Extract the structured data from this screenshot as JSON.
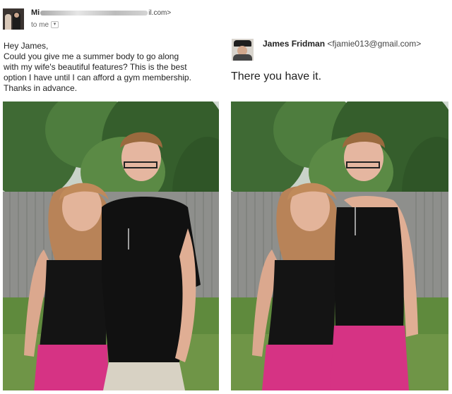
{
  "email": {
    "sender_prefix": "Mi",
    "sender_domain": "il.com>",
    "to_label": "to me",
    "body_lines": [
      "Hey James,",
      "Could you give me a summer body to go along",
      "with my wife's beautiful features? This is the best",
      "option I have until I can afford a gym membership.",
      "Thanks in advance."
    ]
  },
  "reply": {
    "name": "James Fridman",
    "address": "<fjamie013@gmail.com>",
    "text": "There you have it."
  },
  "photos": {
    "left": {
      "description_icon": "couple-photo-original"
    },
    "right": {
      "description_icon": "couple-photo-edited"
    }
  }
}
